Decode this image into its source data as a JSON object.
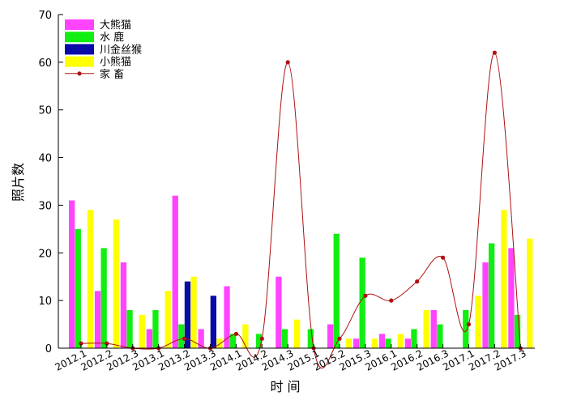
{
  "chart_data": {
    "type": "bar",
    "xlabel": "时 间",
    "ylabel": "照片数",
    "ylim": [
      0,
      70
    ],
    "yticks": [
      0,
      10,
      20,
      30,
      40,
      50,
      60,
      70
    ],
    "grid": false,
    "legend_position": "top-left",
    "categories": [
      "2012.1",
      "2012.2",
      "2012.3",
      "2013.1",
      "2013.2",
      "2013.3",
      "2014.1",
      "2014.2",
      "2014.3",
      "2015.1",
      "2015.2",
      "2015.3",
      "2016.1",
      "2016.2",
      "2016.3",
      "2017.1",
      "2017.2",
      "2017.3"
    ],
    "series": [
      {
        "name": "大熊猫",
        "type": "bar",
        "color": "#ff44ff",
        "values": [
          31,
          12,
          18,
          4,
          32,
          4,
          13,
          0,
          15,
          0,
          5,
          2,
          3,
          2,
          8,
          0,
          18,
          21
        ]
      },
      {
        "name": "水 鹿",
        "type": "bar",
        "color": "#11ee11",
        "values": [
          25,
          21,
          8,
          8,
          5,
          0,
          3,
          3,
          4,
          4,
          24,
          19,
          2,
          4,
          5,
          8,
          22,
          7
        ]
      },
      {
        "name": "川金丝猴",
        "type": "bar",
        "color": "#0a0aa8",
        "values": [
          0,
          0,
          0,
          0,
          14,
          11,
          0,
          0,
          0,
          0,
          0,
          0,
          0,
          0,
          0,
          0,
          0,
          0
        ]
      },
      {
        "name": "小熊猫",
        "type": "bar",
        "color": "#ffff00",
        "values": [
          29,
          27,
          7,
          12,
          15,
          2,
          5,
          0,
          6,
          0,
          2,
          2,
          3,
          8,
          0,
          11,
          29,
          23
        ]
      },
      {
        "name": "家 畜",
        "type": "line",
        "color": "#b01010",
        "values": [
          1,
          1,
          0,
          0,
          2,
          0,
          3,
          2,
          60,
          0,
          2,
          11,
          10,
          14,
          19,
          5,
          62,
          0
        ]
      }
    ]
  }
}
